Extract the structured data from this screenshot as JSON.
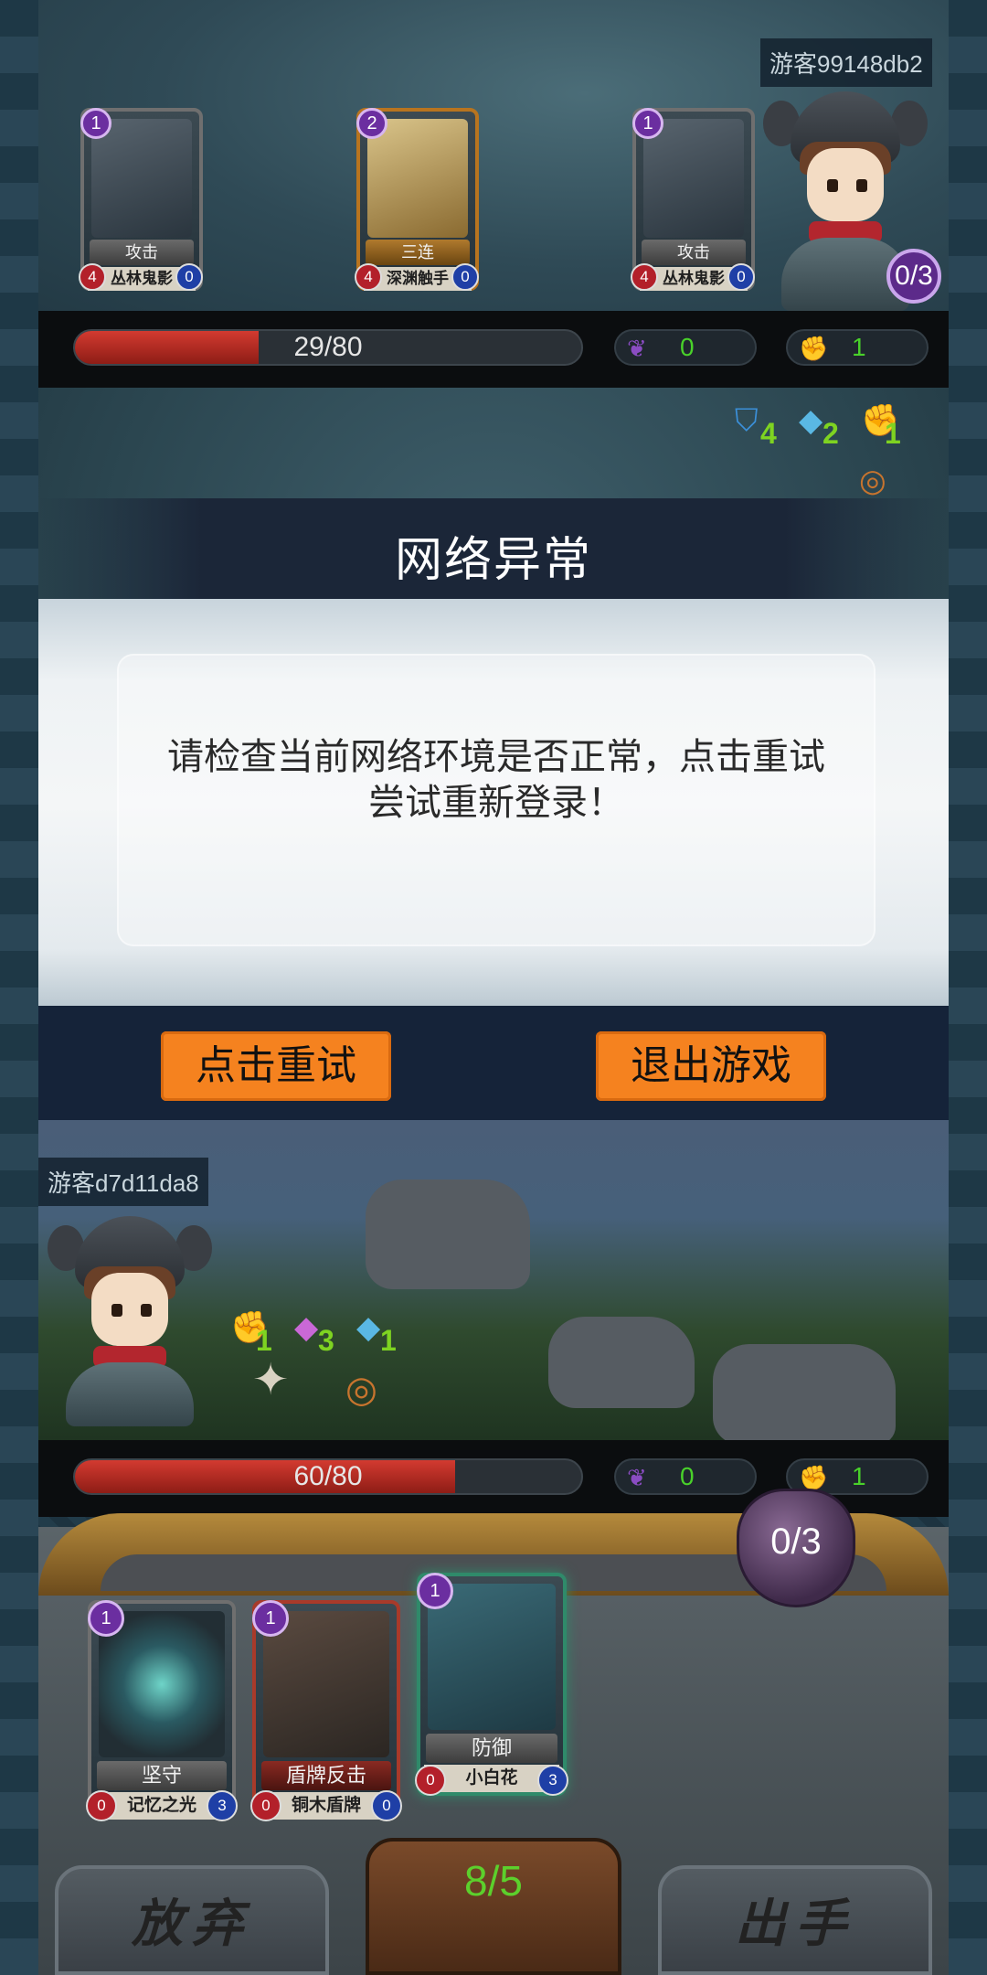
{
  "opponent": {
    "name": "游客99148db2",
    "hp_text": "29/80",
    "hp_fraction": 0.3625,
    "energy_value": "0",
    "power_value": "1",
    "action_counter": "0/3",
    "cards": [
      {
        "cost": "1",
        "title": "攻击",
        "sub": "丛林鬼影",
        "left": "4",
        "right": "0"
      },
      {
        "cost": "2",
        "title": "三连",
        "sub": "深渊触手",
        "left": "4",
        "right": "0"
      },
      {
        "cost": "1",
        "title": "攻击",
        "sub": "丛林鬼影",
        "left": "4",
        "right": "0"
      }
    ],
    "status": {
      "shield": "4",
      "crystal": "2",
      "fist": "1"
    }
  },
  "dialog": {
    "title": "网络异常",
    "message_line1": "请检查当前网络环境是否正常，点击重试",
    "message_line2": "尝试重新登录！",
    "retry_label": "点击重试",
    "exit_label": "退出游戏"
  },
  "player": {
    "name": "游客d7d11da8",
    "hp_text": "60/80",
    "hp_fraction": 0.75,
    "energy_value": "0",
    "power_value": "1",
    "status": {
      "fist": "1",
      "gem": "3",
      "crystal": "1"
    },
    "action_counter": "0/3",
    "deck_count": "8/5",
    "hand": [
      {
        "cost": "1",
        "title": "坚守",
        "sub": "记忆之光",
        "left": "0",
        "right": "3"
      },
      {
        "cost": "1",
        "title": "盾牌反击",
        "sub": "铜木盾牌",
        "left": "0",
        "right": "0"
      },
      {
        "cost": "1",
        "title": "防御",
        "sub": "小白花",
        "left": "0",
        "right": "3"
      }
    ],
    "discard_label": "放弃",
    "play_label": "出手"
  },
  "colors": {
    "hp_red": "#c0302a",
    "resource_green": "#49d12a",
    "button_orange": "#f5821f",
    "dialog_header": "#1b2638"
  },
  "icons": {
    "energy": "leaf-icon",
    "power": "fist-icon",
    "shield": "shield-icon",
    "crystal": "crystal-icon",
    "gem": "gem-icon",
    "bracelet": "bracelet-icon",
    "shuriken": "shuriken-icon"
  }
}
